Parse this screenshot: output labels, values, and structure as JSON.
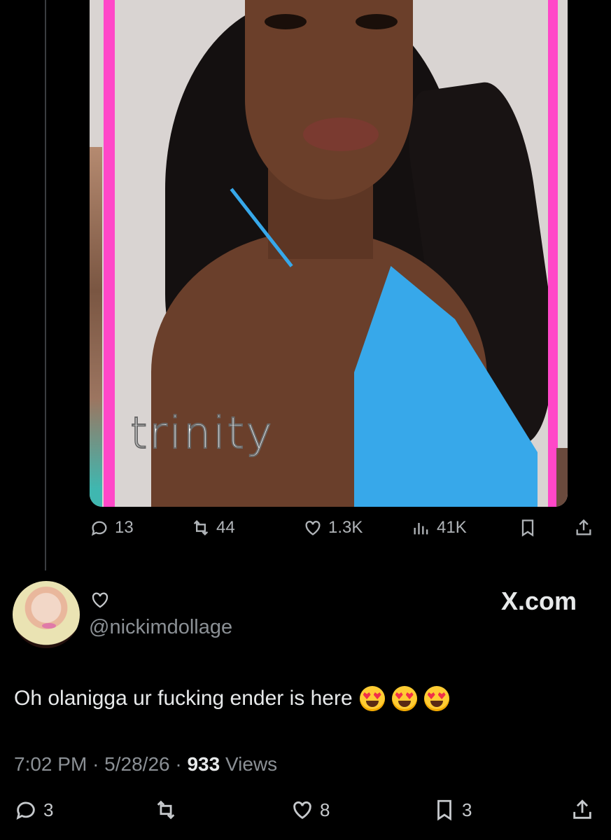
{
  "media": {
    "caption": "trinity"
  },
  "post_actions": {
    "replies": "13",
    "reposts": "44",
    "likes": "1.3K",
    "views": "41K"
  },
  "reply": {
    "handle": "@nickimdollage",
    "watermark": "X.com",
    "text": "Oh olanigga ur fucking ender is here",
    "emoji_count": 3,
    "time": "7:02 PM",
    "date": "5/28/26",
    "views_count": "933",
    "views_label": "Views",
    "separator": "·"
  },
  "reply_actions": {
    "replies": "3",
    "likes": "8",
    "bookmarks": "3"
  },
  "colors": {
    "background": "#000000",
    "accent_pink": "#ff47c8",
    "bikini_blue": "#37a8ea",
    "muted_text": "#8b9095"
  },
  "icons": [
    "reply-icon",
    "repost-icon",
    "like-icon",
    "views-icon",
    "bookmark-icon",
    "share-icon",
    "heart-outline-icon"
  ]
}
